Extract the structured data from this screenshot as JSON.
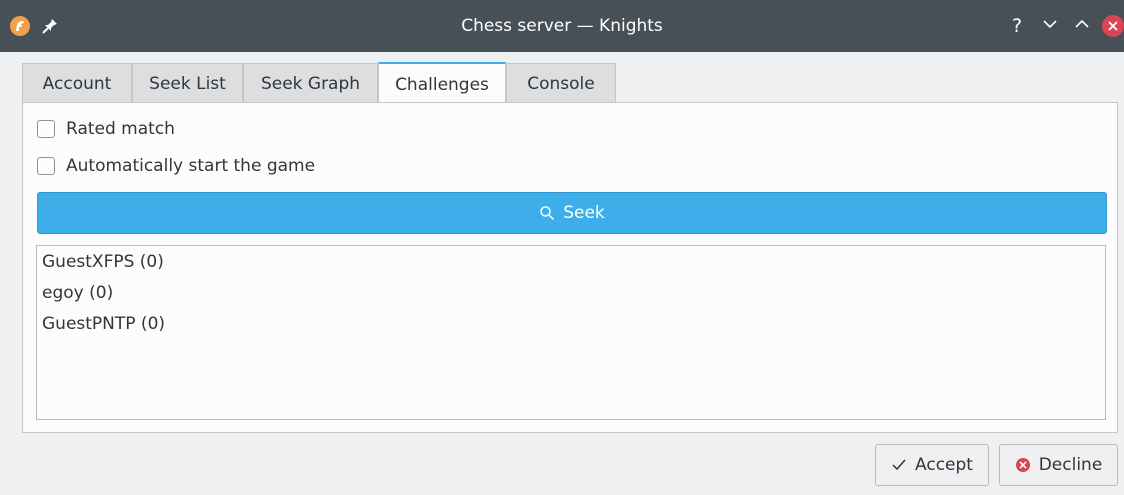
{
  "window": {
    "title": "Chess server — Knights",
    "help_glyph": "?",
    "colors": {
      "titlebar": "#475057",
      "accent": "#3daee9",
      "close": "#da4453"
    }
  },
  "tabs": [
    {
      "label": "Account",
      "active": false
    },
    {
      "label": "Seek List",
      "active": false
    },
    {
      "label": "Seek Graph",
      "active": false
    },
    {
      "label": "Challenges",
      "active": true
    },
    {
      "label": "Console",
      "active": false
    }
  ],
  "options": {
    "rated_label": "Rated match",
    "rated_checked": false,
    "autostart_label": "Automatically start the game",
    "autostart_checked": false
  },
  "seek_button": {
    "label": "Seek",
    "icon": "search-icon"
  },
  "challenges": [
    {
      "name": "GuestXFPS (0)"
    },
    {
      "name": "egoy (0)"
    },
    {
      "name": "GuestPNTP (0)"
    }
  ],
  "actions": {
    "accept_label": "Accept",
    "accept_icon": "check-icon",
    "decline_label": "Decline",
    "decline_icon": "cancel-icon"
  }
}
